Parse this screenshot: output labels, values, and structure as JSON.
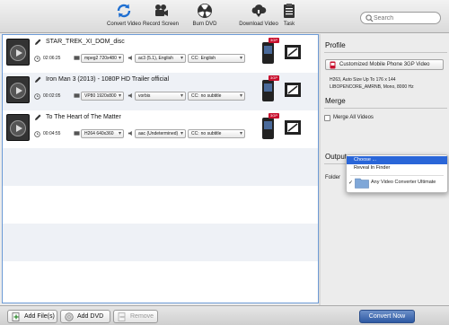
{
  "toolbar": {
    "buttons": [
      {
        "label": "Convert Video"
      },
      {
        "label": "Record Screen"
      },
      {
        "label": "Burn DVD"
      },
      {
        "label": "Download Video"
      },
      {
        "label": "Task"
      }
    ],
    "search_placeholder": "Search"
  },
  "files": [
    {
      "name": "STAR_TREK_XI_DOM_disc",
      "duration": "02:06:25",
      "video": "mpeg2 720x480",
      "audio": "ac3 (5.1), English",
      "subtitle": "English"
    },
    {
      "name": "Iron Man 3 (2013) - 1080P HD Trailer official",
      "duration": "00:02:05",
      "video": "VP80 1920x800",
      "audio": "vorbis",
      "subtitle": "no subtitle"
    },
    {
      "name": "To The Heart of The Matter",
      "duration": "00:04:55",
      "video": "H264 640x360",
      "audio": "aac (Undetermined)",
      "subtitle": "no subtitle"
    }
  ],
  "subtitle_prefix": "CC:",
  "format_badge": "3GP",
  "profile": {
    "section_title": "Profile",
    "button_label": "Customized Mobile Phone 3GP Video",
    "info_line1": "H263, Auto Size Up To 176 x 144",
    "info_line2": "LIBOPENCORE_AMRNB, Mono, 8000 Hz"
  },
  "merge": {
    "section_title": "Merge",
    "checkbox_label": "Merge All Videos",
    "checked": false
  },
  "output": {
    "section_title": "Output",
    "folder_label": "Folder"
  },
  "folder_menu": {
    "items": [
      "Choose ...",
      "Reveal In Finder"
    ],
    "selected_folder": "Any Video Converter Ultimate"
  },
  "bottom": {
    "add_files": "Add File(s)",
    "add_dvd": "Add DVD",
    "remove": "Remove",
    "convert": "Convert Now"
  }
}
